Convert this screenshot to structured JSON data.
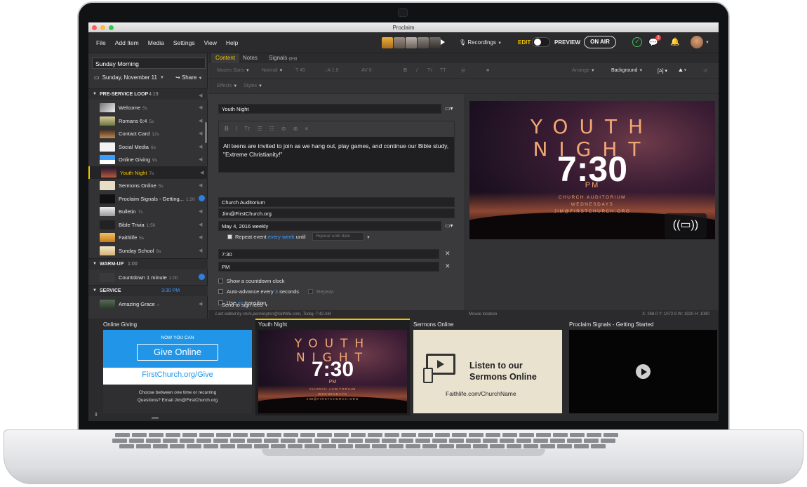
{
  "window": {
    "title": "Proclaim"
  },
  "menu": {
    "items": [
      "File",
      "Add Item",
      "Media",
      "Settings",
      "View",
      "Help"
    ]
  },
  "header": {
    "recordings_label": "Recordings",
    "edit_label": "EDIT",
    "preview_label": "PREVIEW",
    "onair_label": "ON AIR",
    "notification_count": "2"
  },
  "sidebar": {
    "service_name": "Sunday Morning",
    "date": "Sunday, November 11",
    "share_label": "Share",
    "sections": [
      {
        "name": "PRE-SERVICE LOOP",
        "time": "4:19"
      },
      {
        "name": "WARM-UP",
        "time": "1:00"
      },
      {
        "name": "SERVICE",
        "time": "3:30 PM"
      }
    ],
    "items": [
      {
        "label": "Welcome",
        "duration": "5s"
      },
      {
        "label": "Romans 6:4",
        "duration": "5s"
      },
      {
        "label": "Contact Card",
        "duration": "12s"
      },
      {
        "label": "Social Media",
        "duration": "6s"
      },
      {
        "label": "Online Giving",
        "duration": "9s"
      },
      {
        "label": "Youth Night",
        "duration": "7s"
      },
      {
        "label": "Sermons Online",
        "duration": "5s"
      },
      {
        "label": "Proclaim Signals - Getting...",
        "duration": "1:20"
      },
      {
        "label": "Bulletin",
        "duration": "7s"
      },
      {
        "label": "Bible Trivia",
        "duration": "1:50"
      },
      {
        "label": "Faithlife",
        "duration": "5s"
      },
      {
        "label": "Sunday School",
        "duration": "8s"
      },
      {
        "label": "Countdown 1 minute",
        "duration": "1:00"
      },
      {
        "label": "Amazing Grace",
        "duration": "♪"
      }
    ]
  },
  "tabs": {
    "content": "Content",
    "notes": "Notes",
    "signals": "Signals",
    "signals_badge": "(((•)))"
  },
  "format": {
    "font": "Museo Sans",
    "weight": "Normal",
    "size": "45",
    "line_height": "1.0",
    "spacing": "0",
    "arrange": "Arrange",
    "background": "Background",
    "effects": "Effects",
    "styles": "Styles"
  },
  "form": {
    "title": "Youth Night",
    "description": "All teens are invited to join as we hang out, play games, and continue our Bible study, \"Extreme Christianity!\"",
    "location": "Church Auditorium",
    "contact": "Jim@FirstChurch.org",
    "date": "May 4, 2016 weekly",
    "repeat_event": "Repeat event",
    "repeat_freq": "every week",
    "until": "until",
    "repeat_until_placeholder": "Repeat until date",
    "time": "7:30",
    "ampm": "PM",
    "countdown": "Show a countdown clock",
    "auto_advance": "Auto-advance every",
    "auto_seconds": "3",
    "seconds": "seconds",
    "repeat": "Repeat",
    "use": "Use",
    "transition_value": "no",
    "transition": "transition",
    "send_to_sign": "Send to sign feed",
    "last_edited": "Last edited by chris.pennington@faithlife.com, Today 7:42 AM"
  },
  "preview": {
    "title_line1": "YOUTH",
    "title_line2": "NIGHT",
    "time": "7:30",
    "ampm": "PM",
    "detail1": "CHURCH AUDITORIUM",
    "detail2": "WEDNESDAYS",
    "detail3": "JIM@FIRSTCHURCH.ORG"
  },
  "status": {
    "mouse_location": "Mouse location",
    "coords": "X: 268.0  Y: 1072.9    W: 1920  H: 1080"
  },
  "strip": {
    "cards": [
      {
        "title": "Online Giving",
        "line1": "NOW YOU CAN",
        "button": "Give Online",
        "url": "FirstChurch.org/Give",
        "small1": "Choose between one time or recurring",
        "small2": "Questions? Email Jim@FirstChurch.org"
      },
      {
        "title": "Youth Night"
      },
      {
        "title": "Sermons Online",
        "headline1": "Listen to our",
        "headline2": "Sermons Online",
        "url": "Faithlife.com/ChurchName"
      },
      {
        "title": "Proclaim Signals - Getting Started"
      }
    ]
  },
  "colors": {
    "accent": "#f5c400",
    "blue": "#2e7fe0",
    "ok": "#3fc35a"
  }
}
